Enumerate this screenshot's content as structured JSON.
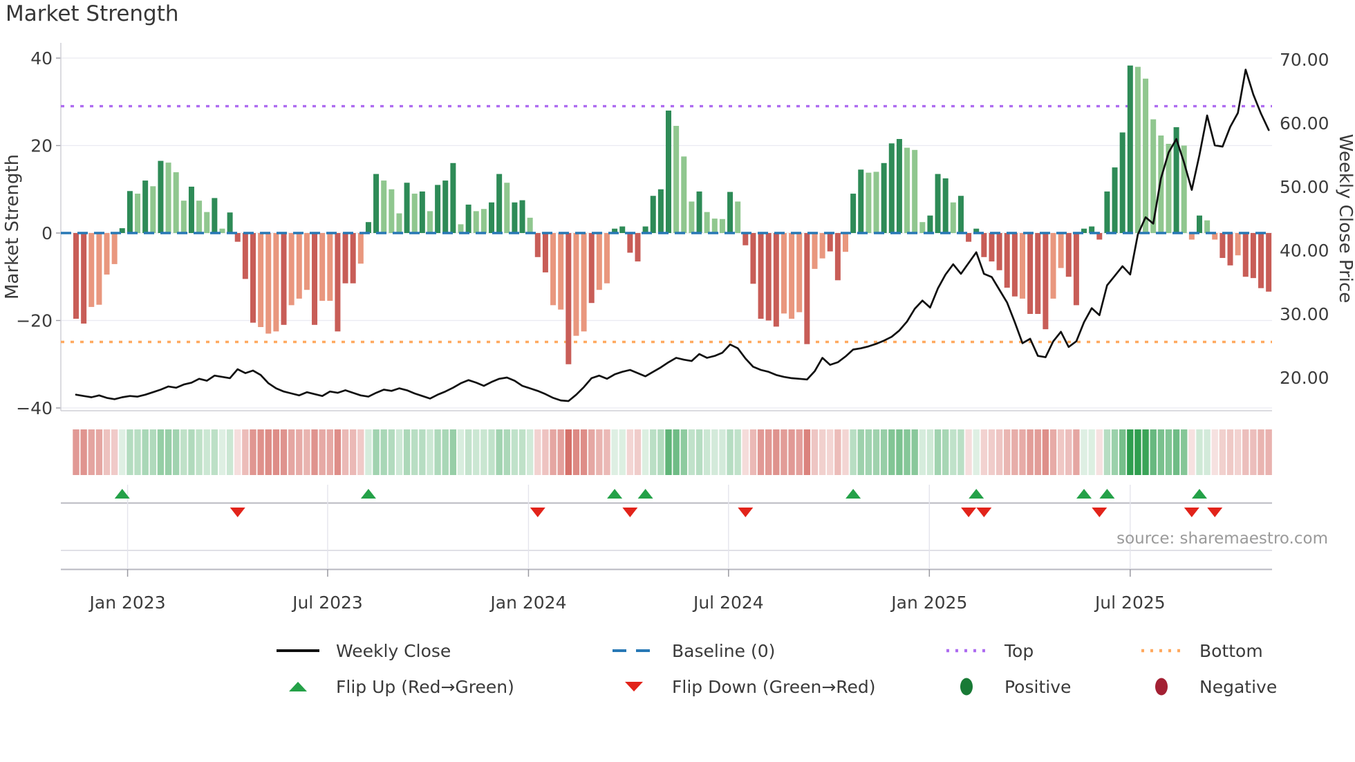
{
  "title": "Market Strength",
  "source_text": "source: sharemaestro.com",
  "axes": {
    "left_label": "Market Strength",
    "right_label": "Weekly Close Price",
    "left_ticks": [
      {
        "label": "40",
        "value": 40
      },
      {
        "label": "20",
        "value": 20
      },
      {
        "label": "0",
        "value": 0
      },
      {
        "label": "−20",
        "value": -20
      },
      {
        "label": "−40",
        "value": -40
      }
    ],
    "right_ticks": [
      {
        "label": "70.00",
        "value": 70
      },
      {
        "label": "60.00",
        "value": 60
      },
      {
        "label": "50.00",
        "value": 50
      },
      {
        "label": "40.00",
        "value": 40
      },
      {
        "label": "30.00",
        "value": 30
      },
      {
        "label": "20.00",
        "value": 20
      }
    ],
    "x_ticks": [
      {
        "label": "Jan 2023",
        "week": 6.7
      },
      {
        "label": "Jul 2023",
        "week": 32.7
      },
      {
        "label": "Jan 2024",
        "week": 58.8
      },
      {
        "label": "Jul 2024",
        "week": 84.8
      },
      {
        "label": "Jan 2025",
        "week": 110.9
      },
      {
        "label": "Jul 2025",
        "week": 137.0
      }
    ]
  },
  "legend": [
    {
      "label": "Weekly Close"
    },
    {
      "label": "Baseline (0)"
    },
    {
      "label": "Top"
    },
    {
      "label": "Bottom"
    },
    {
      "label": "Flip Up (Red→Green)"
    },
    {
      "label": "Flip Down (Green→Red)"
    },
    {
      "label": "Positive"
    },
    {
      "label": "Negative"
    }
  ],
  "colors": {
    "bar_green_dark": "#2e8b57",
    "bar_green_light": "#90c78f",
    "bar_red_dark": "#c85d57",
    "bar_red_light": "#e9977e",
    "baseline": "#2878b5",
    "top_line": "#ad6bf0",
    "bottom_line": "#ffa95f",
    "price_line": "#101010",
    "flip_up": "#24a148",
    "flip_down": "#e2231a",
    "positive_dot": "#187a35",
    "negative_dot": "#a32033",
    "heat_green": "#2f9e4f",
    "heat_red": "#cc5048",
    "grid": "#eaeaf1",
    "spine": "#cfcfd6",
    "tick": "#9a9aa2",
    "band_line": "#b8b8c0"
  },
  "chart_data": {
    "type": "combo_bar_line_heatmap",
    "frequency": "weekly",
    "x_range": "Nov 2022 – Nov 2025",
    "ylim_left": [
      -40,
      40
    ],
    "ylim_right": [
      15,
      72
    ],
    "baseline_value": 0,
    "top_value": 29,
    "bottom_value": -24.9,
    "series": [
      {
        "name": "Market Strength",
        "type": "bar",
        "axis": "left",
        "values": [
          -19.6,
          -20.7,
          -16.9,
          -16.4,
          -9.5,
          -7.1,
          1.1,
          9.6,
          9,
          12,
          10.7,
          16.5,
          16.1,
          13.9,
          7.4,
          10.6,
          7.4,
          4.8,
          8,
          1,
          4.7,
          -2,
          -10.5,
          -20.5,
          -21.5,
          -23,
          -22.5,
          -21,
          -16.5,
          -15,
          -13,
          -21,
          -15.5,
          -15.5,
          -22.5,
          -11.5,
          -11.5,
          -7,
          2.5,
          13.5,
          12,
          10,
          4.5,
          11.5,
          9,
          9.5,
          5,
          11,
          12,
          16,
          2,
          6.5,
          5,
          5.5,
          7,
          13.5,
          11.5,
          7,
          7.5,
          3.5,
          -5.5,
          -9,
          -16.5,
          -17.5,
          -30,
          -23.5,
          -22.5,
          -16,
          -13,
          -11.5,
          1,
          1.5,
          -4.5,
          -6.5,
          1.5,
          8.5,
          10,
          28,
          24.5,
          17.5,
          7.2,
          9.5,
          4.8,
          3.3,
          3.2,
          9.4,
          7.2,
          -2.8,
          -11.6,
          -19.6,
          -20,
          -21.4,
          -18.4,
          -19.6,
          -18.1,
          -25.4,
          -8.2,
          -5.8,
          -4.2,
          -10.8,
          -4.3,
          9,
          14.5,
          13.8,
          14,
          16,
          20.5,
          21.5,
          19.5,
          19,
          2.5,
          4,
          13.5,
          12.5,
          7,
          8.5,
          -2,
          1,
          -5.5,
          -6.5,
          -8.5,
          -12.5,
          -14.5,
          -15,
          -18.5,
          -18.5,
          -22,
          -15,
          -8,
          -10,
          -16.5,
          1,
          1.5,
          -1.5,
          9.5,
          15,
          23,
          38.3,
          38,
          35.3,
          26,
          22.3,
          20.4,
          24.2,
          20,
          -1.5,
          4,
          2.9,
          -1.5,
          -5.7,
          -7.4,
          -5.1,
          -10,
          -10.3,
          -12.6,
          -13.4
        ],
        "shade_codes": "rrRRRRggGgGgGGGgGGgGgrrrRRRrRRRrRRrrrRggGGGgGgGgggGgGGggGggGrrRRrRRrRRggrrggggGGGgGGGgGrrrrrRRRrRRrrRggGGgggGGGgggGgrgrrrrrRrrrRRrrggrggggGGGGGgGRgGRrrRrrrr"
      },
      {
        "name": "Weekly Close",
        "type": "line",
        "axis": "right",
        "values": [
          17.3,
          17.1,
          16.9,
          17.2,
          16.8,
          16.6,
          16.9,
          17.1,
          17.0,
          17.3,
          17.7,
          18.1,
          18.6,
          18.4,
          18.9,
          19.2,
          19.8,
          19.5,
          20.3,
          20.1,
          19.9,
          21.3,
          20.7,
          21.1,
          20.4,
          19.1,
          18.3,
          17.8,
          17.5,
          17.2,
          17.7,
          17.4,
          17.1,
          17.8,
          17.6,
          18.0,
          17.6,
          17.2,
          17.0,
          17.6,
          18.1,
          17.9,
          18.3,
          18.0,
          17.5,
          17.1,
          16.7,
          17.3,
          17.8,
          18.4,
          19.1,
          19.6,
          19.2,
          18.7,
          19.3,
          19.8,
          20.0,
          19.5,
          18.7,
          18.3,
          17.9,
          17.4,
          16.8,
          16.4,
          16.3,
          17.3,
          18.5,
          19.9,
          20.3,
          19.8,
          20.5,
          20.9,
          21.2,
          20.7,
          20.2,
          20.9,
          21.6,
          22.4,
          23.1,
          22.8,
          22.6,
          23.7,
          23.1,
          23.4,
          23.9,
          25.2,
          24.6,
          23.0,
          21.7,
          21.2,
          20.9,
          20.4,
          20.1,
          19.9,
          19.8,
          19.7,
          21.0,
          23.1,
          22.0,
          22.4,
          23.3,
          24.4,
          24.6,
          24.9,
          25.3,
          25.8,
          26.4,
          27.4,
          28.8,
          30.8,
          32.1,
          31.0,
          34.0,
          36.2,
          37.8,
          36.3,
          38.0,
          39.7,
          36.3,
          35.8,
          33.8,
          31.8,
          28.7,
          25.4,
          26.1,
          23.4,
          23.2,
          25.7,
          27.2,
          24.8,
          25.7,
          28.7,
          30.9,
          29.8,
          34.5,
          36.0,
          37.5,
          36.2,
          42.5,
          45.2,
          44.2,
          51.3,
          55.4,
          57.5,
          53.8,
          49.5,
          55.0,
          61.2,
          56.5,
          56.3,
          59.4,
          61.6,
          68.4,
          64.5,
          61.5,
          58.9
        ]
      }
    ],
    "markers": {
      "flip_up_weeks": [
        6,
        38,
        70,
        74,
        101,
        117,
        131,
        134,
        146
      ],
      "flip_down_weeks": [
        21,
        60,
        72,
        87,
        116,
        118,
        133,
        145,
        148
      ]
    },
    "heatmap": "cells mirror bar sign; opacity scales with |value|"
  }
}
